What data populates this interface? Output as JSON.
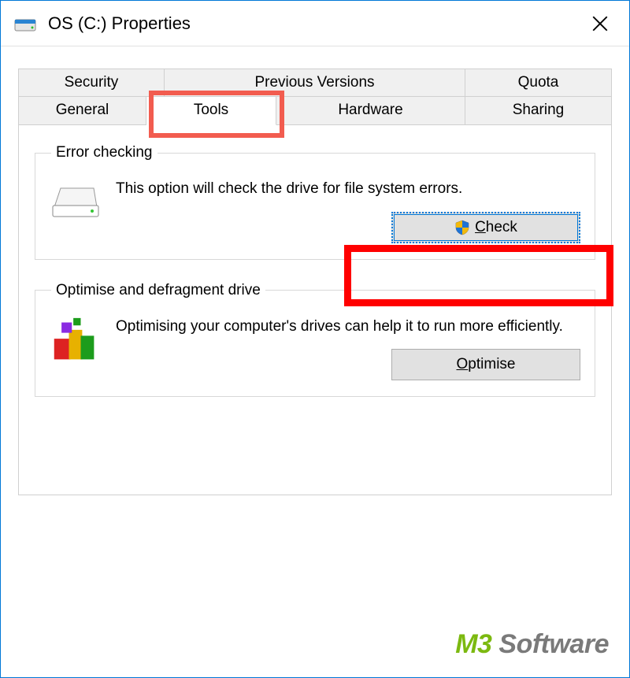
{
  "titlebar": {
    "title": "OS (C:) Properties"
  },
  "tabs": {
    "row1": [
      "Security",
      "Previous Versions",
      "Quota"
    ],
    "row2": [
      "General",
      "Tools",
      "Hardware",
      "Sharing"
    ],
    "active": "Tools"
  },
  "groups": {
    "error_checking": {
      "legend": "Error checking",
      "desc": "This option will check the drive for file system errors.",
      "button": {
        "prefix": "C",
        "rest": "heck"
      }
    },
    "optimise": {
      "legend": "Optimise and defragment drive",
      "desc": "Optimising your computer's drives can help it to run more efficiently.",
      "button": {
        "prefix": "O",
        "rest": "ptimise"
      }
    }
  },
  "watermark": {
    "m3": "M3",
    "soft": " Software"
  }
}
